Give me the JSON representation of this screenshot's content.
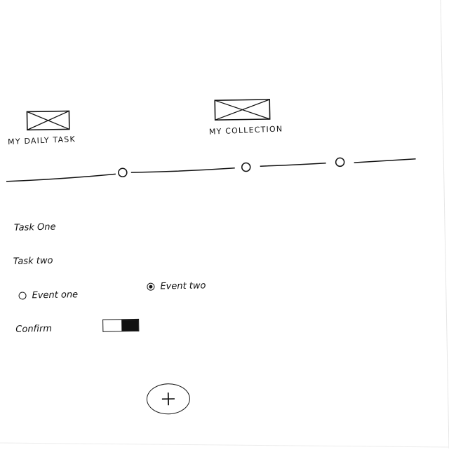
{
  "header": {
    "cards": [
      {
        "label": "MY DAILY TASK",
        "image_icon": "image-placeholder-icon"
      },
      {
        "label": "MY COLLECTION",
        "image_icon": "image-placeholder-icon"
      }
    ]
  },
  "stepper": {
    "steps": 3
  },
  "tasks": [
    {
      "label": "Task One"
    },
    {
      "label": "Task two"
    }
  ],
  "events": {
    "options": [
      {
        "label": "Event one",
        "selected": false
      },
      {
        "label": "Event two",
        "selected": true
      }
    ]
  },
  "confirm": {
    "label": "Confirm",
    "toggle_on": true
  },
  "fab": {
    "icon": "plus-icon"
  },
  "colors": {
    "ink": "#111111",
    "paper": "#ffffff"
  }
}
